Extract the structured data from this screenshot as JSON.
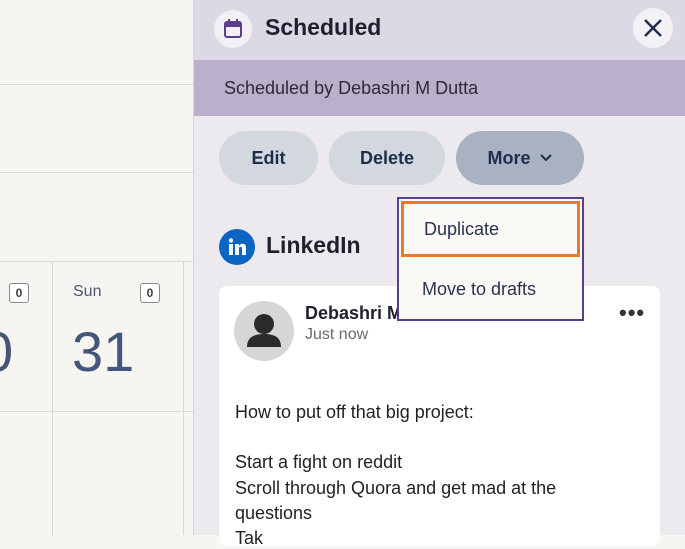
{
  "calendar": {
    "left_count": "0",
    "left_day_number_partial": "0",
    "sun_label": "Sun",
    "sun_count": "0",
    "sun_number": "31"
  },
  "panel": {
    "title": "Scheduled",
    "icon": "calendar-icon",
    "close_icon": "close-icon",
    "scheduled_by": "Scheduled by Debashri M Dutta",
    "actions": {
      "edit": "Edit",
      "delete": "Delete",
      "more": "More"
    },
    "dropdown": {
      "items": [
        "Duplicate",
        "Move to drafts"
      ]
    },
    "network": {
      "name": "LinkedIn",
      "icon": "linkedin-icon",
      "brand_color": "#0a66c2"
    },
    "post": {
      "author": "Debashri M",
      "time": "Just now",
      "more_icon": "more-dots-icon",
      "lines": [
        "How to put off that big project:",
        "",
        "Start a fight on reddit",
        "Scroll through Quora and get mad at the",
        "questions",
        "Tak"
      ]
    }
  },
  "colors": {
    "accent_purple": "#5b3e8a",
    "focus_orange": "#e8792d"
  }
}
